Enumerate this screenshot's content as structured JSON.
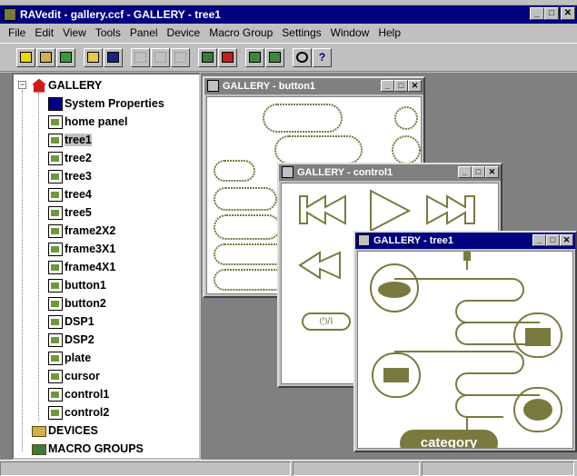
{
  "window": {
    "title": "RAVedit - gallery.ccf - GALLERY - tree1",
    "min": "_",
    "max": "□",
    "close": "✕"
  },
  "menu": [
    "File",
    "Edit",
    "View",
    "Tools",
    "Panel",
    "Device",
    "Macro Group",
    "Settings",
    "Window",
    "Help"
  ],
  "toolbar": [
    "new-icon",
    "open-panel-icon",
    "add-icon",
    "folder-open-icon",
    "save-icon",
    "cut-icon",
    "copy-icon",
    "paste-icon",
    "edit-icon",
    "record-icon",
    "import-icon",
    "export-icon",
    "target-icon",
    "help-icon"
  ],
  "tree": {
    "root": "GALLERY",
    "items": [
      "System Properties",
      "home panel",
      "tree1",
      "tree2",
      "tree3",
      "tree4",
      "tree5",
      "frame2X2",
      "frame3X1",
      "frame4X1",
      "button1",
      "button2",
      "DSP1",
      "DSP2",
      "plate",
      "cursor",
      "control1",
      "control2"
    ],
    "selected": "tree1",
    "devices": "DEVICES",
    "macro_groups": "MACRO GROUPS"
  },
  "windows": {
    "button1": {
      "title": "GALLERY - button1"
    },
    "control1": {
      "title": "GALLERY - control1",
      "power_label": "⏻/I"
    },
    "tree1": {
      "title": "GALLERY - tree1",
      "category_label": "category"
    }
  },
  "colors": {
    "accent": "#7a7a40",
    "active_title": "#000080",
    "inactive_title": "#808080"
  }
}
